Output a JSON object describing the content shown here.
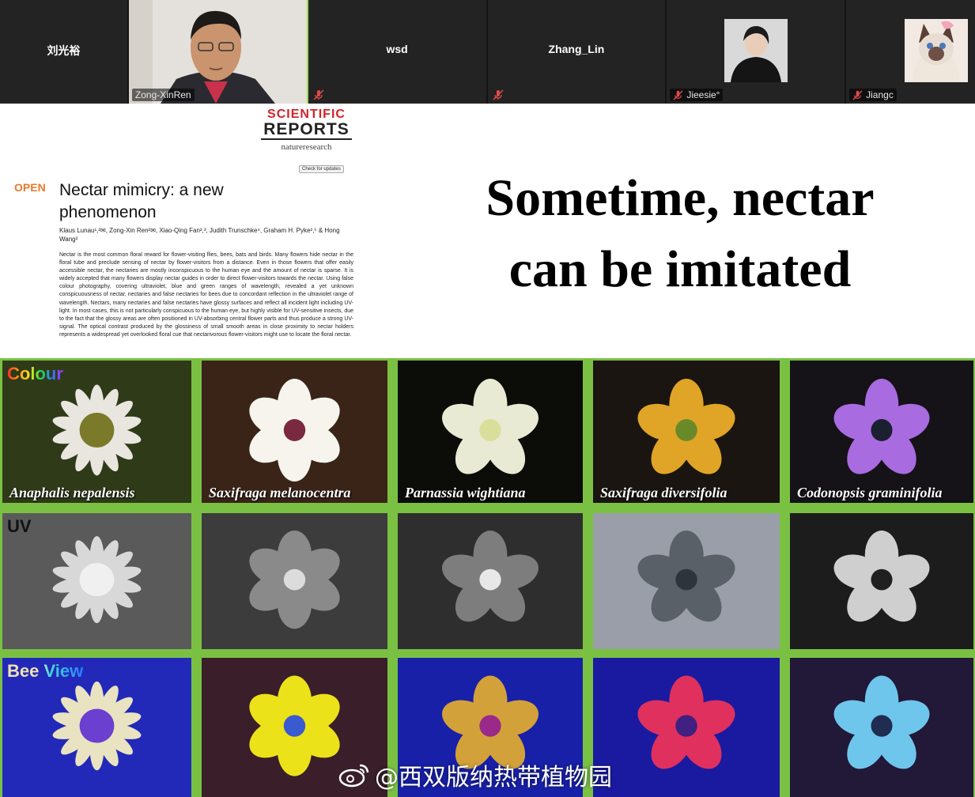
{
  "meeting": {
    "participants": [
      {
        "name": "刘光裕",
        "muted": false,
        "video": false
      },
      {
        "name": "Zong-XinRen",
        "muted": false,
        "video": true,
        "speaking": true
      },
      {
        "name": "wsd",
        "muted": true,
        "video": false
      },
      {
        "name": "Zhang_Lin",
        "muted": true,
        "video": false
      },
      {
        "name": "Jieesie°",
        "muted": true,
        "video": false,
        "avatar": "person-photo"
      },
      {
        "name": "Jiangc",
        "muted": true,
        "video": false,
        "avatar": "cat-photo"
      }
    ]
  },
  "slide": {
    "journal": {
      "line1": "SCIENTIFIC",
      "line2": "REPORTS",
      "line3": "natureresearch"
    },
    "check_updates": "Check for updates",
    "open_label": "OPEN",
    "paper_title": "Nectar mimicry: a new phenomenon",
    "authors": "Klaus Lunau¹,²✉, Zong-Xin Ren²✉, Xiao-Qing Fan²,³, Judith Trunschke⁴, Graham H. Pyke²,⁵ & Hong Wang²",
    "abstract": "Nectar is the most common floral reward for flower-visiting flies, bees, bats and birds. Many flowers hide nectar in the floral tube and preclude sensing of nectar by flower-visitors from a distance. Even in those flowers that offer easily accessible nectar, the nectaries are mostly inconspicuous to the human eye and the amount of nectar is sparse. It is widely accepted that many flowers display nectar guides in order to direct flower-visitors towards the nectar. Using false colour photography, covering ultraviolet, blue and green ranges of wavelength, revealed a yet unknown conspicuousness of nectar, nectaries and false nectaries for bees due to concordant reflection in the ultraviolet range of wavelength. Nectars, many nectaries and false nectaries have glossy surfaces and reflect all incident light including UV-light. In most cases, this is not particularly conspicuous to the human eye, but highly visible for UV-sensitive insects, due to the fact that the glossy areas are often positioned in UV-absorbing central flower parts and thus produce a strong UV-signal. The optical contrast produced by the glossiness of small smooth areas in close proximity to nectar holders represents a widespread yet overlooked floral cue that nectarivorous flower-visitors might use to locate the floral nectar.",
    "headline_line1": "Sometime, nectar",
    "headline_line2": "can be imitated",
    "row_labels": [
      "Colour",
      "UV",
      "Bee View"
    ],
    "species": [
      "Anaphalis nepalensis",
      "Saxifraga melanocentra",
      "Parnassia wightiana",
      "Saxifraga diversifolia",
      "Codonopsis graminifolia"
    ]
  },
  "watermark": "@西双版纳热带植物园",
  "colors": {
    "grid_border": "#7ac143",
    "open_orange": "#e8782a",
    "journal_red": "#d2232a",
    "active_speaker": "#a3d65b"
  }
}
